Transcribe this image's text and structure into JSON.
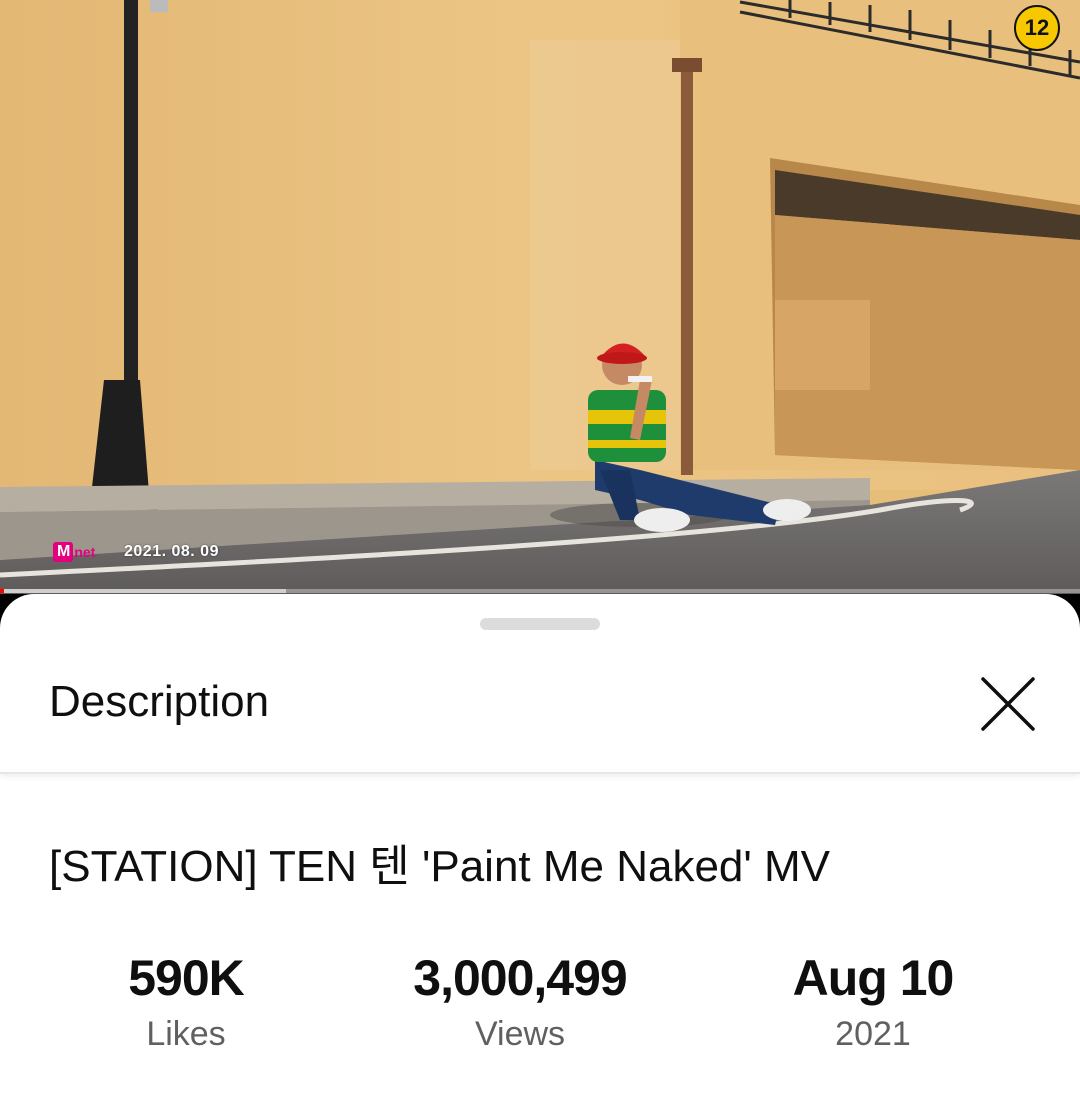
{
  "player": {
    "age_rating": "12",
    "channel_logo": {
      "letter": "M",
      "text": "net"
    },
    "broadcast_date": "2021. 08. 09",
    "progress_fraction": 0.004,
    "buffered_fraction": 0.265
  },
  "sheet": {
    "title": "Description",
    "close_icon": "close-icon"
  },
  "video": {
    "title": "[STATION] TEN 텐 'Paint Me Naked' MV",
    "stats": [
      {
        "value": "590K",
        "label": "Likes"
      },
      {
        "value": "3,000,499",
        "label": "Views"
      },
      {
        "value": "Aug 10",
        "label": "2021"
      }
    ]
  },
  "colors": {
    "progress": "#ff0000",
    "age_badge": "#f7c800",
    "mnet_pink": "#e3007f"
  }
}
